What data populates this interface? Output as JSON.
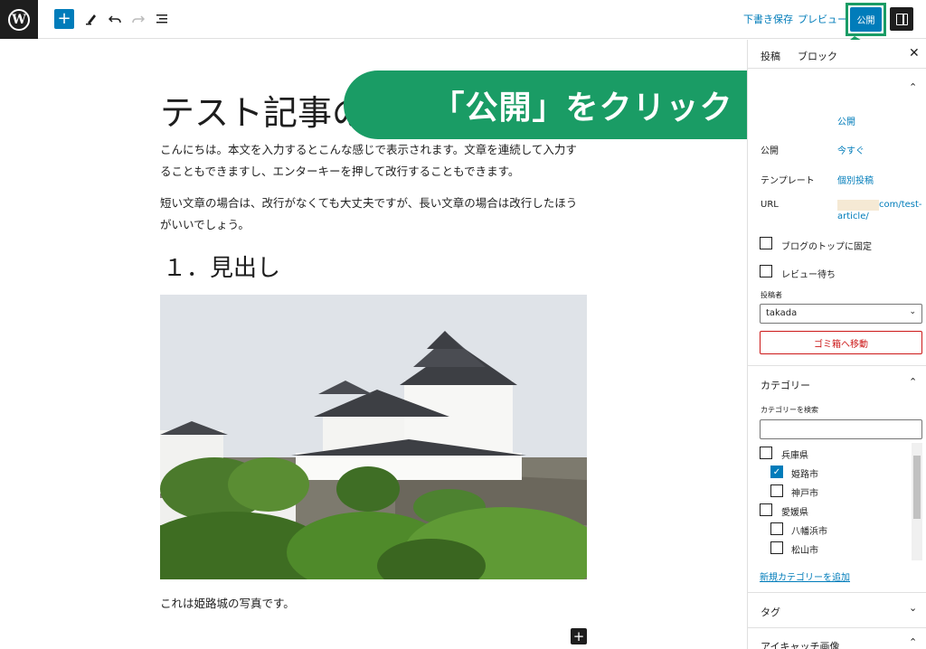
{
  "toolbar": {
    "draft_label": "下書き保存",
    "preview_label": "プレビュー",
    "publish_label": "公開"
  },
  "post": {
    "title": "テスト記事の",
    "paragraph1": "こんにちは。本文を入力するとこんな感じで表示されます。文章を連続して入力することもできますし、エンターキーを押して改行することもできます。",
    "paragraph2": "短い文章の場合は、改行がなくても大丈夫ですが、長い文章の場合は改行したほうがいいでしょう。",
    "heading": "１．見出し",
    "caption": "これは姫路城の写真です。"
  },
  "callout": {
    "text": "「公開」をクリック",
    "color": "#1a9c65"
  },
  "sidebar": {
    "tabs": [
      "投稿",
      "ブロック"
    ],
    "status": {
      "label": "",
      "value": "公開"
    },
    "publish": {
      "label": "公開",
      "value": "今すぐ"
    },
    "template": {
      "label": "テンプレート",
      "value": "個別投稿"
    },
    "url": {
      "label": "URL",
      "value_line1": "com/test-",
      "value_line2": "article/"
    },
    "sticky_label": "ブログのトップに固定",
    "pending_label": "レビュー待ち",
    "author": {
      "label": "投稿者",
      "value": "takada"
    },
    "trash_label": "ゴミ箱へ移動",
    "categories": {
      "title": "カテゴリー",
      "search_label": "カテゴリーを検索",
      "items": [
        {
          "label": "兵庫県",
          "checked": false,
          "level": 0
        },
        {
          "label": "姫路市",
          "checked": true,
          "level": 1
        },
        {
          "label": "神戸市",
          "checked": false,
          "level": 1
        },
        {
          "label": "愛媛県",
          "checked": false,
          "level": 0
        },
        {
          "label": "八幡浜市",
          "checked": false,
          "level": 1
        },
        {
          "label": "松山市",
          "checked": false,
          "level": 1
        }
      ],
      "add_link": "新規カテゴリーを追加"
    },
    "tags_title": "タグ",
    "featured_title": "アイキャッチ画像"
  },
  "colors": {
    "accent": "#007cba",
    "danger": "#cc1818",
    "highlight": "#1a9c65"
  }
}
